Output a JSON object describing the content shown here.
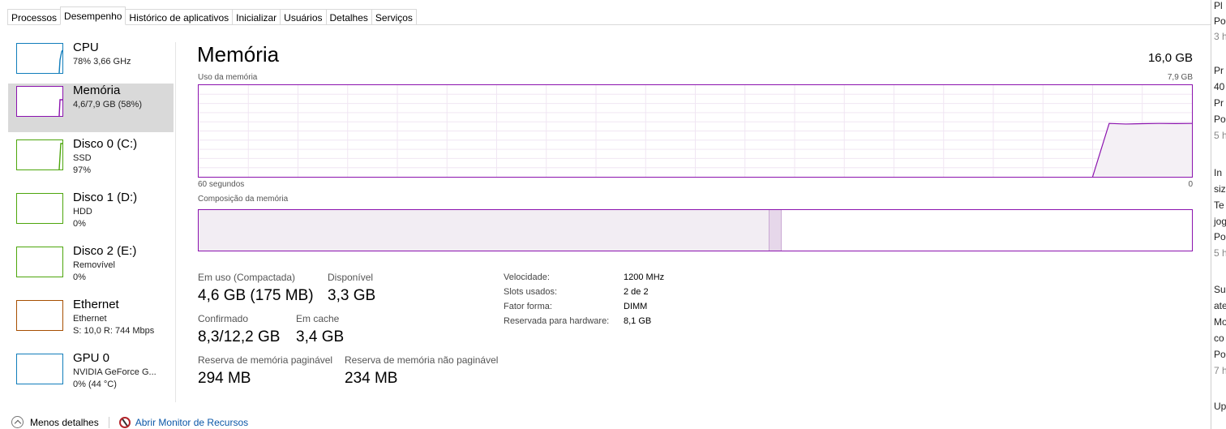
{
  "tabs": [
    "Processos",
    "Desempenho",
    "Histórico de aplicativos",
    "Inicializar",
    "Usuários",
    "Detalhes",
    "Serviços"
  ],
  "active_tab": "Desempenho",
  "sidebar": [
    {
      "title": "CPU",
      "sub": "78% 3,66 GHz",
      "sub2": "",
      "color": "#117dbb",
      "selected": false
    },
    {
      "title": "Memória",
      "sub": "4,6/7,9 GB (58%)",
      "sub2": "",
      "color": "#8b12ae",
      "selected": true
    },
    {
      "title": "Disco 0 (C:)",
      "sub": "SSD",
      "sub2": "97%",
      "color": "#4da60c",
      "selected": false
    },
    {
      "title": "Disco 1 (D:)",
      "sub": "HDD",
      "sub2": "0%",
      "color": "#4da60c",
      "selected": false
    },
    {
      "title": "Disco 2 (E:)",
      "sub": "Removível",
      "sub2": "0%",
      "color": "#4da60c",
      "selected": false
    },
    {
      "title": "Ethernet",
      "sub": "Ethernet",
      "sub2": "S: 10,0  R: 744 Mbps",
      "color": "#a74f01",
      "selected": false
    },
    {
      "title": "GPU 0",
      "sub": "NVIDIA GeForce G...",
      "sub2": "0% (44 °C)",
      "color": "#117dbb",
      "selected": false
    }
  ],
  "main": {
    "title": "Memória",
    "total": "16,0 GB",
    "usage_label": "Uso da memória",
    "usage_max": "7,9 GB",
    "time_left": "60 segundos",
    "time_right": "0",
    "composition_label": "Composição da memória",
    "accent_color": "#8b12ae"
  },
  "stats": {
    "in_use_label": "Em uso (Compactada)",
    "in_use_value": "4,6 GB (175 MB)",
    "available_label": "Disponível",
    "available_value": "3,3 GB",
    "committed_label": "Confirmado",
    "committed_value": "8,3/12,2 GB",
    "cached_label": "Em cache",
    "cached_value": "3,4 GB",
    "paged_label": "Reserva de memória paginável",
    "paged_value": "294 MB",
    "nonpaged_label": "Reserva de memória não paginável",
    "nonpaged_value": "234 MB"
  },
  "properties": [
    {
      "label": "Velocidade:",
      "value": "1200 MHz"
    },
    {
      "label": "Slots usados:",
      "value": "2 de 2"
    },
    {
      "label": "Fator forma:",
      "value": "DIMM"
    },
    {
      "label": "Reservada para hardware:",
      "value": "8,1 GB"
    }
  ],
  "footer": {
    "less_details": "Menos detalhes",
    "monitor_link": "Abrir Monitor de Recursos"
  },
  "chart_data": {
    "type": "area",
    "title": "Uso da memória",
    "xlabel": "",
    "x_range_label": [
      "60 segundos",
      "0"
    ],
    "ylim": [
      0,
      7.9
    ],
    "y_unit": "GB",
    "values": [
      0,
      0,
      0,
      0,
      0,
      0,
      0,
      0,
      0,
      0,
      0,
      0,
      0,
      0,
      0,
      0,
      0,
      0,
      0,
      0,
      0,
      0,
      0,
      0,
      0,
      0,
      0,
      0,
      0,
      0,
      0,
      0,
      0,
      0,
      0,
      0,
      0,
      0,
      0,
      0,
      0,
      0,
      0,
      0,
      0,
      0,
      0,
      0,
      0,
      0,
      0,
      0,
      0,
      0,
      0,
      4.6,
      4.55,
      4.58,
      4.6,
      4.59,
      4.6
    ],
    "composition": {
      "in_use_fraction": 0.575,
      "modified_fraction": 0.012
    }
  },
  "right_panel_lines": [
    "Pl",
    "Po",
    "3 h",
    "Pr",
    "40",
    "Pr",
    "Po",
    "5 h",
    "In",
    "siz",
    "Te",
    "jog",
    "Po",
    "5 h",
    "Su",
    "ate",
    "Mo",
    "co",
    "Po",
    "7 h",
    "Up"
  ]
}
